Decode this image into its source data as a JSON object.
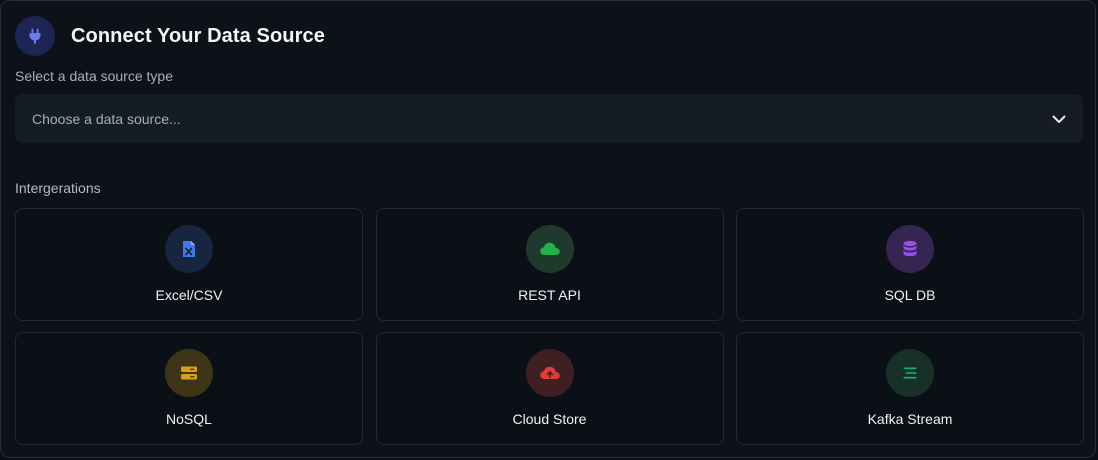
{
  "header": {
    "title": "Connect Your Data Source",
    "icon": "plug-icon",
    "icon_bg": "#1c2553",
    "icon_color": "#6c7cf0"
  },
  "source_select": {
    "label": "Select a data source type",
    "placeholder": "Choose a data source...",
    "icon": "chevron-down-icon"
  },
  "integrations": {
    "label": "Intergerations",
    "items": [
      {
        "label": "Excel/CSV",
        "icon": "file-excel-icon",
        "icon_bg": "#172540",
        "icon_color": "#3b7ae8"
      },
      {
        "label": "REST API",
        "icon": "cloud-icon",
        "icon_bg": "#1f3a2c",
        "icon_color": "#22b04b"
      },
      {
        "label": "SQL DB",
        "icon": "database-icon",
        "icon_bg": "#362553",
        "icon_color": "#9b4ee8"
      },
      {
        "label": "NoSQL",
        "icon": "server-icon",
        "icon_bg": "#3d3516",
        "icon_color": "#d9a017"
      },
      {
        "label": "Cloud Store",
        "icon": "cloud-upload-icon",
        "icon_bg": "#3f1f22",
        "icon_color": "#e23b3b"
      },
      {
        "label": "Kafka Stream",
        "icon": "stream-icon",
        "icon_bg": "#173129",
        "icon_color": "#1ab08a"
      }
    ]
  }
}
